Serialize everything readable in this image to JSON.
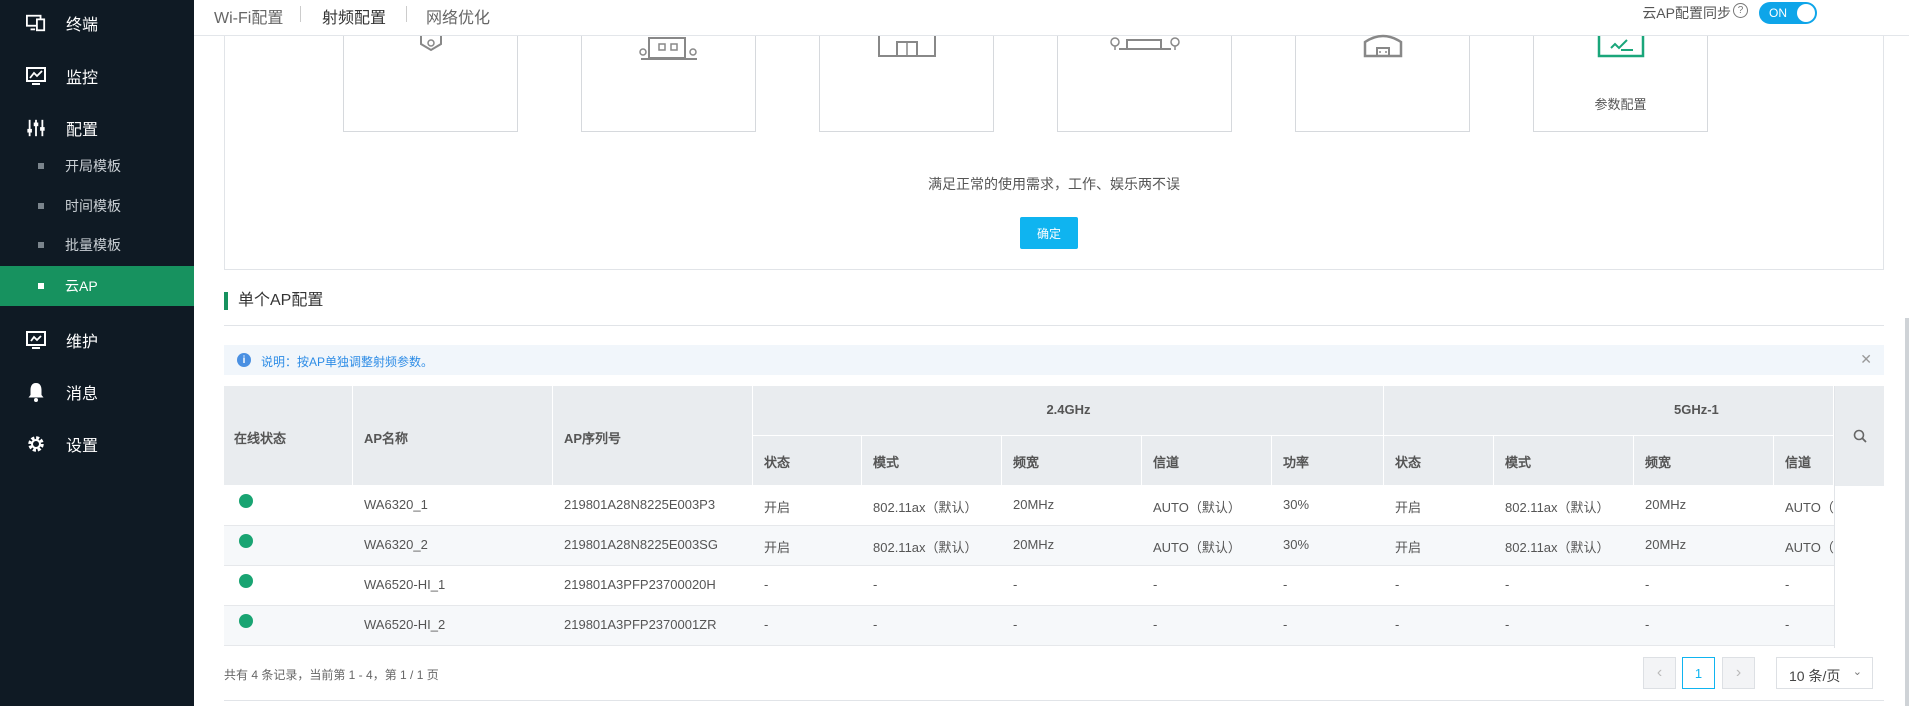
{
  "sidebar": {
    "items": [
      {
        "label": "终端",
        "icon": "monitor-icon"
      },
      {
        "label": "监控",
        "icon": "chart-monitor-icon"
      },
      {
        "label": "配置",
        "icon": "sliders-icon"
      },
      {
        "label": "维护",
        "icon": "maintenance-icon"
      },
      {
        "label": "消息",
        "icon": "bell-icon"
      },
      {
        "label": "设置",
        "icon": "gear-icon"
      }
    ],
    "sub_items": [
      {
        "label": "开局模板",
        "active": false
      },
      {
        "label": "时间模板",
        "active": false
      },
      {
        "label": "批量模板",
        "active": false
      },
      {
        "label": "云AP",
        "active": true
      }
    ]
  },
  "topbar": {
    "tabs": [
      {
        "label": "Wi-Fi配置",
        "active": false
      },
      {
        "label": "射频配置",
        "active": true
      },
      {
        "label": "网络优化",
        "active": false
      }
    ],
    "sync_label": "云AP配置同步",
    "toggle_label": "ON",
    "toggle_on": true,
    "accent": "#0ea5e9"
  },
  "scenarios": {
    "cards": [
      {
        "label": "",
        "icon": "home-scene-icon"
      },
      {
        "label": "",
        "icon": "building-scene-icon"
      },
      {
        "label": "",
        "icon": "store-scene-icon"
      },
      {
        "label": "",
        "icon": "outdoor-scene-icon"
      },
      {
        "label": "",
        "icon": "hall-scene-icon"
      },
      {
        "label": "参数配置",
        "icon": "custom-config-icon"
      }
    ],
    "description": "满足正常的使用需求，工作、娱乐两不误",
    "confirm_label": "确定"
  },
  "single_ap": {
    "title": "单个AP配置",
    "notice": "说明：按AP单独调整射频参数。",
    "columns": {
      "online_status": "在线状态",
      "ap_name": "AP名称",
      "ap_serial": "AP序列号",
      "band_24": "2.4GHz",
      "band_5": "5GHz-1",
      "sub_24": [
        "状态",
        "模式",
        "频宽",
        "信道",
        "功率"
      ],
      "sub_5": [
        "状态",
        "模式",
        "频宽",
        "信道"
      ]
    },
    "rows": [
      {
        "name": "WA6320_1",
        "serial": "219801A28N8225E003P3",
        "b24": [
          "开启",
          "802.11ax（默认）",
          "20MHz",
          "AUTO（默认）",
          "30%"
        ],
        "b5": [
          "开启",
          "802.11ax（默认）",
          "20MHz",
          "AUTO（"
        ]
      },
      {
        "name": "WA6320_2",
        "serial": "219801A28N8225E003SG",
        "b24": [
          "开启",
          "802.11ax（默认）",
          "20MHz",
          "AUTO（默认）",
          "30%"
        ],
        "b5": [
          "开启",
          "802.11ax（默认）",
          "20MHz",
          "AUTO（"
        ]
      },
      {
        "name": "WA6520-HI_1",
        "serial": "219801A3PFP23700020H",
        "b24": [
          "-",
          "-",
          "-",
          "-",
          "-"
        ],
        "b5": [
          "-",
          "-",
          "-",
          "-"
        ]
      },
      {
        "name": "WA6520-HI_2",
        "serial": "219801A3PFP2370001ZR",
        "b24": [
          "-",
          "-",
          "-",
          "-",
          "-"
        ],
        "b5": [
          "-",
          "-",
          "-",
          "-"
        ]
      }
    ],
    "online_color": "#19a472"
  },
  "pagination": {
    "summary": "共有 4 条记录，当前第 1 - 4，第 1 / 1 页",
    "current_page": "1",
    "prev": "‹",
    "next": "›",
    "page_size": "10 条/页"
  }
}
